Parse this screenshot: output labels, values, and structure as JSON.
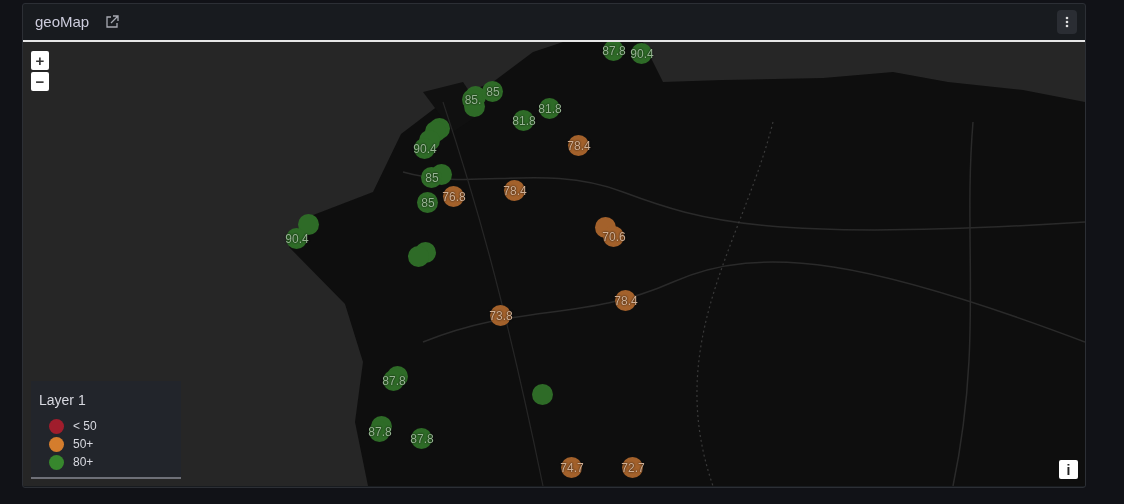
{
  "panel": {
    "title": "geoMap"
  },
  "map": {
    "zoom_in": "+",
    "zoom_out": "−",
    "info": "i"
  },
  "markers": [
    {
      "label": "87.8",
      "color": "#2e6b27"
    },
    {
      "label": "90.4",
      "color": "#2e6b27"
    },
    {
      "color": "#2e6b27"
    },
    {
      "label": "85.",
      "color": "#2e6b27"
    },
    {
      "label": "85",
      "color": "#2e6b27"
    },
    {
      "color": "#2e6b27"
    },
    {
      "label": "81.8",
      "color": "#2e6b27"
    },
    {
      "label": "81.8",
      "color": "#2e6b27"
    },
    {
      "color": "#2e6b27"
    },
    {
      "color": "#2e6b27"
    },
    {
      "color": "#2e6b27"
    },
    {
      "label": "90.4",
      "color": "#2e6b27"
    },
    {
      "color": "#2e6b27"
    },
    {
      "label": "85",
      "color": "#2e6b27"
    },
    {
      "label": "85",
      "color": "#2e6b27"
    },
    {
      "label": "76.8",
      "color": "#a3612b"
    },
    {
      "label": "78.4",
      "color": "#a3612b"
    },
    {
      "label": "78.4",
      "color": "#a3612b"
    },
    {
      "color": "#2e6b27"
    },
    {
      "label": "90.4",
      "color": "#2e6b27"
    },
    {
      "color": "#2e6b27"
    },
    {
      "color": "#2e6b27"
    },
    {
      "color": "#a3612b"
    },
    {
      "label": "70.6",
      "color": "#a3612b"
    },
    {
      "label": "73.8",
      "color": "#a3612b"
    },
    {
      "label": "78.4",
      "color": "#a3612b"
    },
    {
      "color": "#2e6b27"
    },
    {
      "label": "87.8",
      "color": "#2e6b27"
    },
    {
      "color": "#2e6b27"
    },
    {
      "color": "#2e6b27"
    },
    {
      "label": "87.8",
      "color": "#2e6b27"
    },
    {
      "label": "87.8",
      "color": "#2e6b27"
    },
    {
      "label": "74.7",
      "color": "#a3612b"
    },
    {
      "label": "72.7",
      "color": "#a3612b"
    }
  ],
  "legend": {
    "title": "Layer 1",
    "items": [
      {
        "label": "< 50",
        "color": "#a01d2c"
      },
      {
        "label": "50+",
        "color": "#d47d2d"
      },
      {
        "label": "80+",
        "color": "#37872d"
      }
    ]
  }
}
